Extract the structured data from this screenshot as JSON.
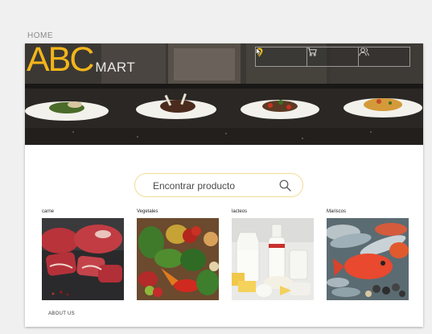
{
  "page": {
    "label": "HOME"
  },
  "header": {
    "brand_main": "ABC",
    "brand_sub": "MART",
    "nav": [
      {
        "name": "location",
        "icon": "map-pin-icon"
      },
      {
        "name": "cart",
        "icon": "cart-icon"
      },
      {
        "name": "users",
        "icon": "users-icon"
      }
    ]
  },
  "search": {
    "placeholder": "Encontrar producto"
  },
  "categories": [
    {
      "label": "carne"
    },
    {
      "label": "Vegetales"
    },
    {
      "label": "lacteos"
    },
    {
      "label": "Mariscos"
    }
  ],
  "footer": {
    "about": "ABOUT US"
  },
  "colors": {
    "brand": "#f3b51a",
    "search_border": "#f2dc95"
  }
}
